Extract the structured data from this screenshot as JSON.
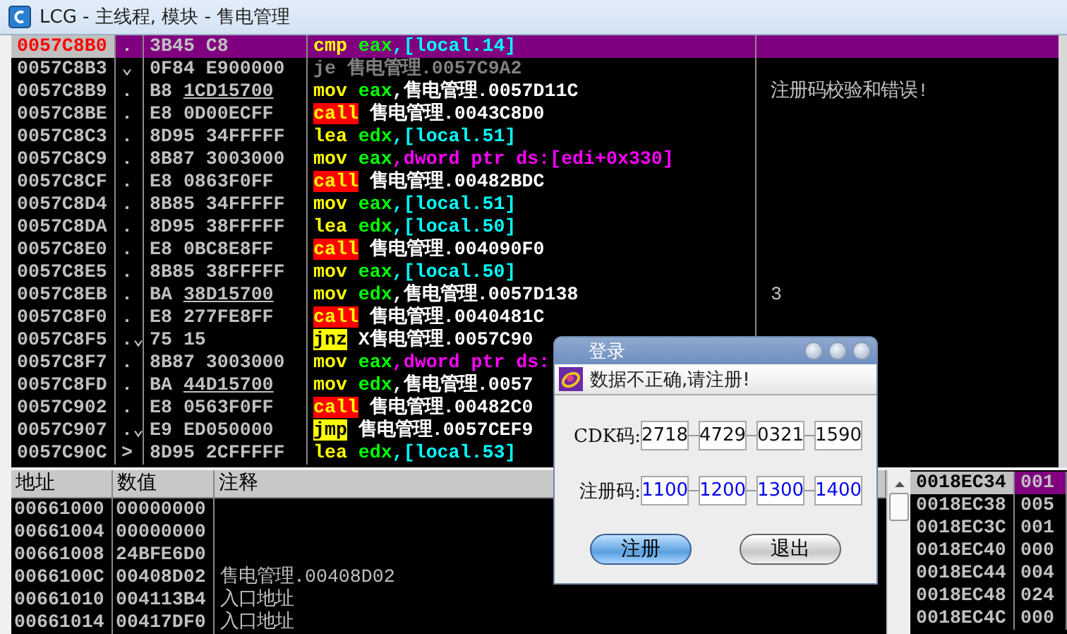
{
  "window": {
    "title": "LCG - 主线程, 模块 - 售电管理"
  },
  "disassembly": {
    "rows": [
      {
        "addr": "0057C8B0",
        "selected": true,
        "marker": ".",
        "op": "3B45",
        "arg": "C8",
        "underline": false,
        "instr": [
          {
            "t": "cmp",
            "kind": "mn"
          },
          {
            "t": " eax",
            "kind": "reg"
          },
          {
            "t": ",[local.14]",
            "kind": "mem"
          }
        ]
      },
      {
        "addr": "0057C8B3",
        "selected": false,
        "marker": "⌄",
        "op": "0F84",
        "arg": "E900000",
        "underline": false,
        "instr": [
          {
            "t": "je 售电管理.0057C9A2",
            "kind": "dim"
          }
        ]
      },
      {
        "addr": "0057C8B9",
        "selected": false,
        "marker": ".",
        "op": "B8",
        "arg": "1CD15700",
        "underline": true,
        "instr": [
          {
            "t": "mov",
            "kind": "mn"
          },
          {
            "t": " eax",
            "kind": "reg"
          },
          {
            "t": ",售电管理.0057D11C",
            "kind": "sym"
          }
        ],
        "comment": "注册码校验和错误!"
      },
      {
        "addr": "0057C8BE",
        "selected": false,
        "marker": ".",
        "op": "E8",
        "arg": "0D00ECFF",
        "underline": false,
        "instr": [
          {
            "t": "call",
            "kind": "call"
          },
          {
            "t": " 售电管理.0043C8D0",
            "kind": "sym"
          }
        ]
      },
      {
        "addr": "0057C8C3",
        "selected": false,
        "marker": ".",
        "op": "8D95",
        "arg": "34FFFFF",
        "underline": false,
        "instr": [
          {
            "t": "lea",
            "kind": "mn"
          },
          {
            "t": " edx",
            "kind": "reg"
          },
          {
            "t": ",[local.51]",
            "kind": "mem"
          }
        ]
      },
      {
        "addr": "0057C8C9",
        "selected": false,
        "marker": ".",
        "op": "8B87",
        "arg": "3003000",
        "underline": false,
        "instr": [
          {
            "t": "mov",
            "kind": "mn"
          },
          {
            "t": " eax",
            "kind": "reg"
          },
          {
            "t": ",dword ptr ds:[edi+0x330]",
            "kind": "ptr"
          }
        ]
      },
      {
        "addr": "0057C8CF",
        "selected": false,
        "marker": ".",
        "op": "E8",
        "arg": "0863F0FF",
        "underline": false,
        "instr": [
          {
            "t": "call",
            "kind": "call"
          },
          {
            "t": " 售电管理.00482BDC",
            "kind": "sym"
          }
        ]
      },
      {
        "addr": "0057C8D4",
        "selected": false,
        "marker": ".",
        "op": "8B85",
        "arg": "34FFFFF",
        "underline": false,
        "instr": [
          {
            "t": "mov",
            "kind": "mn"
          },
          {
            "t": " eax",
            "kind": "reg"
          },
          {
            "t": ",[local.51]",
            "kind": "mem"
          }
        ]
      },
      {
        "addr": "0057C8DA",
        "selected": false,
        "marker": ".",
        "op": "8D95",
        "arg": "38FFFFF",
        "underline": false,
        "instr": [
          {
            "t": "lea",
            "kind": "mn"
          },
          {
            "t": " edx",
            "kind": "reg"
          },
          {
            "t": ",[local.50]",
            "kind": "mem"
          }
        ]
      },
      {
        "addr": "0057C8E0",
        "selected": false,
        "marker": ".",
        "op": "E8",
        "arg": "0BC8E8FF",
        "underline": false,
        "instr": [
          {
            "t": "call",
            "kind": "call"
          },
          {
            "t": " 售电管理.004090F0",
            "kind": "sym"
          }
        ]
      },
      {
        "addr": "0057C8E5",
        "selected": false,
        "marker": ".",
        "op": "8B85",
        "arg": "38FFFFF",
        "underline": false,
        "instr": [
          {
            "t": "mov",
            "kind": "mn"
          },
          {
            "t": " eax",
            "kind": "reg"
          },
          {
            "t": ",[local.50]",
            "kind": "mem"
          }
        ]
      },
      {
        "addr": "0057C8EB",
        "selected": false,
        "marker": ".",
        "op": "BA",
        "arg": "38D15700",
        "underline": true,
        "instr": [
          {
            "t": "mov",
            "kind": "mn"
          },
          {
            "t": " edx",
            "kind": "reg"
          },
          {
            "t": ",售电管理.0057D138",
            "kind": "sym"
          }
        ],
        "comment": "3"
      },
      {
        "addr": "0057C8F0",
        "selected": false,
        "marker": ".",
        "op": "E8",
        "arg": "277FE8FF",
        "underline": false,
        "instr": [
          {
            "t": "call",
            "kind": "call"
          },
          {
            "t": " 售电管理.0040481C",
            "kind": "sym"
          }
        ]
      },
      {
        "addr": "0057C8F5",
        "selected": false,
        "marker": ".⌄",
        "op": "75",
        "arg": "15",
        "underline": false,
        "instr": [
          {
            "t": "jnz",
            "kind": "jmp"
          },
          {
            "t": " X售电管理.0057C90",
            "kind": "sym"
          }
        ]
      },
      {
        "addr": "0057C8F7",
        "selected": false,
        "marker": ".",
        "op": "8B87",
        "arg": "3003000",
        "underline": false,
        "instr": [
          {
            "t": "mov",
            "kind": "mn"
          },
          {
            "t": " eax",
            "kind": "reg"
          },
          {
            "t": ",dword ptr ds:",
            "kind": "ptr"
          }
        ]
      },
      {
        "addr": "0057C8FD",
        "selected": false,
        "marker": ".",
        "op": "BA",
        "arg": "44D15700",
        "underline": true,
        "instr": [
          {
            "t": "mov",
            "kind": "mn"
          },
          {
            "t": " edx",
            "kind": "reg"
          },
          {
            "t": ",售电管理.0057",
            "kind": "sym"
          }
        ]
      },
      {
        "addr": "0057C902",
        "selected": false,
        "marker": ".",
        "op": "E8",
        "arg": "0563F0FF",
        "underline": false,
        "instr": [
          {
            "t": "call",
            "kind": "call"
          },
          {
            "t": " 售电管理.00482C0",
            "kind": "sym"
          }
        ]
      },
      {
        "addr": "0057C907",
        "selected": false,
        "marker": ".⌄",
        "op": "E9",
        "arg": "ED050000",
        "underline": false,
        "instr": [
          {
            "t": "jmp",
            "kind": "jmp"
          },
          {
            "t": " 售电管理.0057CEF9",
            "kind": "sym"
          }
        ]
      },
      {
        "addr": "0057C90C",
        "selected": false,
        "marker": ">",
        "op": "8D95",
        "arg": "2CFFFFF",
        "underline": false,
        "instr": [
          {
            "t": "lea",
            "kind": "mn"
          },
          {
            "t": " edx",
            "kind": "reg"
          },
          {
            "t": ",[local.53]",
            "kind": "mem"
          }
        ]
      }
    ]
  },
  "dump": {
    "columns": [
      "地址",
      "数值",
      "注释"
    ],
    "rows": [
      {
        "addr": "00661000",
        "value": "00000000"
      },
      {
        "addr": "00661004",
        "value": "00000000"
      },
      {
        "addr": "00661008",
        "value": "24BFE6D0"
      },
      {
        "addr": "0066100C",
        "value": "00408D02",
        "comment": "售电管理.00408D02"
      },
      {
        "addr": "00661010",
        "value": "004113B4",
        "comment": "入口地址"
      },
      {
        "addr": "00661014",
        "value": "00417DF0",
        "comment": "入口地址"
      }
    ]
  },
  "stack": {
    "rows": [
      {
        "addr": "0018EC34",
        "value": "001",
        "selected": true
      },
      {
        "addr": "0018EC38",
        "value": "005",
        "selected": false
      },
      {
        "addr": "0018EC3C",
        "value": "001",
        "selected": false
      },
      {
        "addr": "0018EC40",
        "value": "000",
        "selected": false
      },
      {
        "addr": "0018EC44",
        "value": "004",
        "selected": false
      },
      {
        "addr": "0018EC48",
        "value": "024",
        "selected": false
      },
      {
        "addr": "0018EC4C",
        "value": "000",
        "selected": false
      }
    ]
  },
  "dialog": {
    "title": "登录",
    "message": "数据不正确,请注册!",
    "fields": [
      {
        "label": "CDK码:",
        "kind": "cdk",
        "values": [
          "2718",
          "4729",
          "0321",
          "1590"
        ]
      },
      {
        "label": "注册码:",
        "kind": "reg",
        "values": [
          "1100",
          "1200",
          "1300",
          "1400"
        ]
      }
    ],
    "buttons": [
      {
        "label": "注册",
        "kind": "primary"
      },
      {
        "label": "退出",
        "kind": "secondary"
      }
    ]
  }
}
